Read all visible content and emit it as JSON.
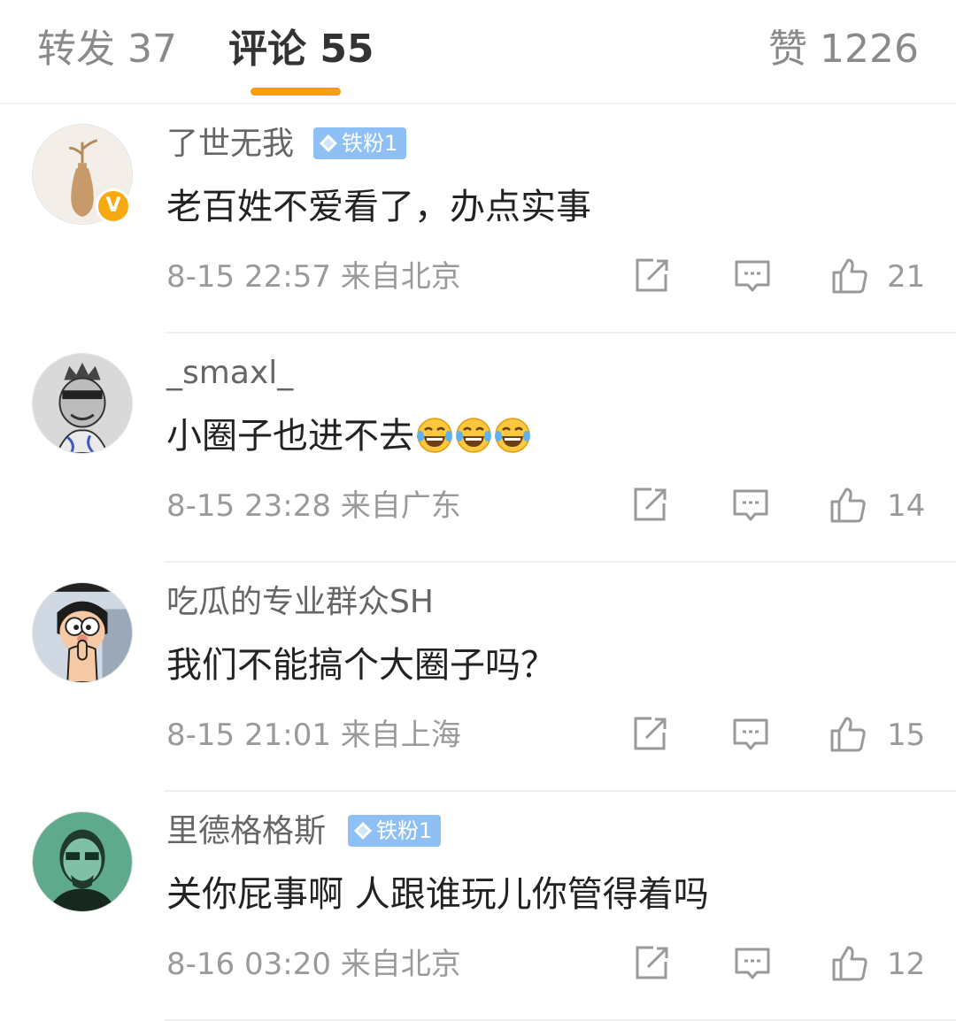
{
  "tabs": {
    "forward": "转发 37",
    "comments": "评论 55",
    "likes": "赞 1226",
    "active_color": "#f89f0a"
  },
  "comments": [
    {
      "user": "了世无我",
      "badge": "铁粉1",
      "verified": true,
      "avatar": "vase-avatar",
      "text": "老百姓不爱看了，办点实事",
      "time": "8-15 22:57",
      "location": "来自北京",
      "likes": "21"
    },
    {
      "user": "_smaxl_",
      "badge": "",
      "verified": false,
      "avatar": "ape-avatar",
      "text": "小圈子也进不去",
      "emojis": [
        "laugh-cry-emoji",
        "laugh-cry-emoji",
        "laugh-cry-emoji"
      ],
      "time": "8-15 23:28",
      "location": "来自广东",
      "likes": "14"
    },
    {
      "user": "吃瓜的专业群众SH",
      "badge": "",
      "verified": false,
      "avatar": "cartoon-avatar",
      "text": "我们不能搞个大圈子吗？",
      "time": "8-15 21:01",
      "location": "来自上海",
      "likes": "15"
    },
    {
      "user": "里德格格斯",
      "badge": "铁粉1",
      "verified": false,
      "avatar": "portrait-avatar",
      "text": "关你屁事啊 人跟谁玩儿你管得着吗",
      "time": "8-16 03:20",
      "location": "来自北京",
      "likes": "12"
    }
  ],
  "icons": {
    "share": "share-icon",
    "reply": "comment-icon",
    "like": "thumbs-up-icon",
    "fan_badge": "diamond-icon"
  },
  "colors": {
    "fan_badge": "#8ec0f5",
    "verified_badge": "#f8a90f"
  }
}
